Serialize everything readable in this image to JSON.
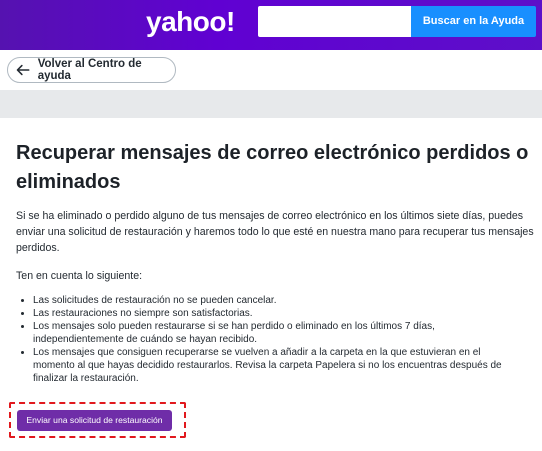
{
  "header": {
    "logo_text": "yahoo!",
    "search_placeholder": "",
    "search_button_label": "Buscar en la Ayuda"
  },
  "nav": {
    "back_label": "Volver al Centro de ayuda"
  },
  "article": {
    "title": "Recuperar mensajes de correo electrónico perdidos o eliminados",
    "intro": "Si se ha eliminado o perdido alguno de tus mensajes de correo electrónico en los últimos siete días, puedes enviar una solicitud de restauración y haremos todo lo que esté en nuestra mano para recuperar tus mensajes perdidos.",
    "note": "Ten en cuenta lo siguiente:",
    "bullets": [
      "Las solicitudes de restauración no se pueden cancelar.",
      "Las restauraciones no siempre son satisfactorias.",
      "Los mensajes solo pueden restaurarse si se han perdido o eliminado en los últimos 7 días, independientemente de cuándo se hayan recibido.",
      "Los mensajes que consiguen recuperarse se vuelven a añadir a la carpeta en la que estuvieran en el momento al que hayas decidido restaurarlos. Revisa la carpeta Papelera si no los encuentras después de finalizar la restauración."
    ],
    "restore_button_label": "Enviar una solicitud de restauración"
  },
  "colors": {
    "header_purple": "#6001d2",
    "search_blue": "#188fff",
    "button_purple": "#6f2da8",
    "highlight_red": "#e1191e"
  },
  "icons": {
    "back": "arrow-left-icon"
  }
}
